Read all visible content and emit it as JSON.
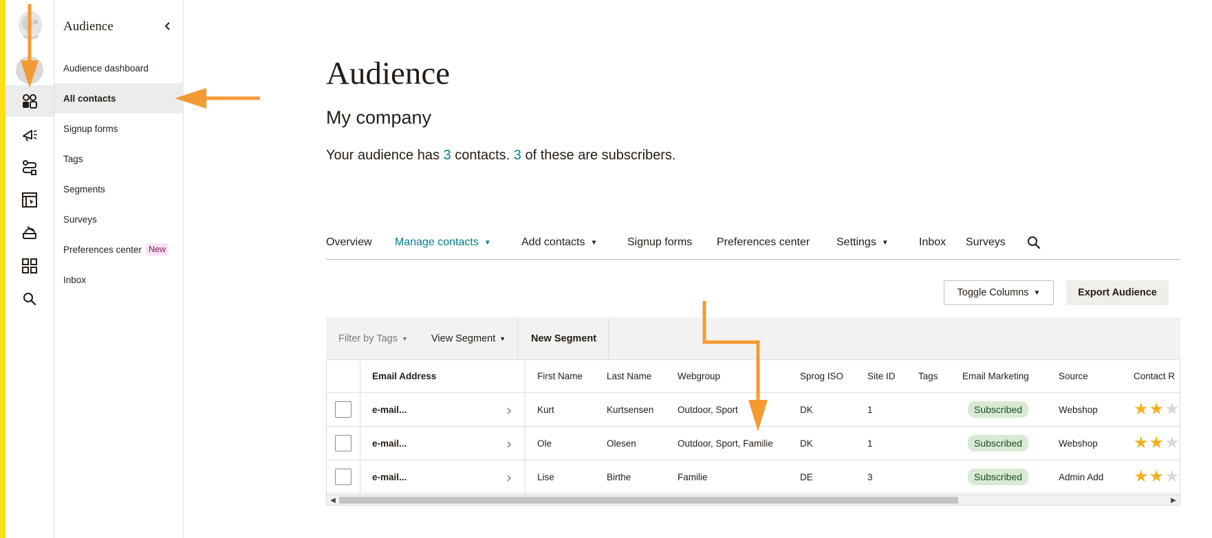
{
  "colors": {
    "accent": "#007c89",
    "brand_yellow": "#ffe01b",
    "annotation_arrow": "#f59a33",
    "subscribed_bg": "#d9ead3"
  },
  "rail": {
    "items": [
      {
        "name": "avatar"
      },
      {
        "name": "audience-icon",
        "active": true
      },
      {
        "name": "campaigns-icon"
      },
      {
        "name": "automations-icon"
      },
      {
        "name": "website-icon"
      },
      {
        "name": "content-icon"
      },
      {
        "name": "integrations-icon"
      },
      {
        "name": "search-icon"
      }
    ]
  },
  "subnav": {
    "title": "Audience",
    "items": [
      {
        "label": "Audience dashboard"
      },
      {
        "label": "All contacts",
        "active": true
      },
      {
        "label": "Signup forms"
      },
      {
        "label": "Tags"
      },
      {
        "label": "Segments"
      },
      {
        "label": "Surveys"
      },
      {
        "label": "Preferences center",
        "badge": "New"
      },
      {
        "label": "Inbox"
      }
    ]
  },
  "main": {
    "title": "Audience",
    "company": "My company",
    "summary": {
      "prefix": "Your audience has ",
      "contacts": "3",
      "middle": " contacts. ",
      "subscribers": "3",
      "suffix": " of these are subscribers."
    }
  },
  "tabs": [
    {
      "label": "Overview",
      "dropdown": false
    },
    {
      "label": "Manage contacts",
      "dropdown": true,
      "active": true
    },
    {
      "label": "Add contacts",
      "dropdown": true
    },
    {
      "label": "Signup forms",
      "dropdown": false
    },
    {
      "label": "Preferences center",
      "dropdown": false
    },
    {
      "label": "Settings",
      "dropdown": true
    },
    {
      "label": "Inbox",
      "dropdown": false
    },
    {
      "label": "Surveys",
      "dropdown": false
    }
  ],
  "toolbar": {
    "toggle_columns": "Toggle Columns",
    "export": "Export Audience"
  },
  "filterbar": {
    "filter_tags": "Filter by Tags",
    "view_segment": "View Segment",
    "new_segment": "New Segment"
  },
  "table": {
    "headers": [
      "Email Address",
      "First Name",
      "Last Name",
      "Webgroup",
      "Sprog ISO",
      "Site ID",
      "Tags",
      "Email Marketing",
      "Source",
      "Contact R"
    ],
    "rows": [
      {
        "email": "e-mail...",
        "first": "Kurt",
        "last": "Kurtsensen",
        "webgroup": "Outdoor, Sport",
        "sprog": "DK",
        "site": "1",
        "tags": "",
        "marketing": "Subscribed",
        "source": "Webshop",
        "rating": 2
      },
      {
        "email": "e-mail...",
        "first": "Ole",
        "last": "Olesen",
        "webgroup": "Outdoor, Sport, Familie",
        "sprog": "DK",
        "site": "1",
        "tags": "",
        "marketing": "Subscribed",
        "source": "Webshop",
        "rating": 2
      },
      {
        "email": "e-mail...",
        "first": "Lise",
        "last": "Birthe",
        "webgroup": "Familie",
        "sprog": "DE",
        "site": "3",
        "tags": "",
        "marketing": "Subscribed",
        "source": "Admin Add",
        "rating": 2
      }
    ]
  }
}
